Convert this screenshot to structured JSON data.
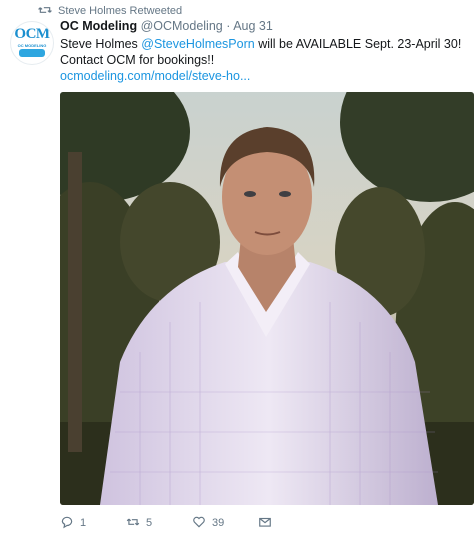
{
  "retweet_context": {
    "text": "Steve Holmes Retweeted",
    "icon": "retweet-icon"
  },
  "tweet": {
    "author": {
      "name": "OC Modeling",
      "handle": "@OCModeling",
      "avatar_logo_text": "OCM",
      "avatar_logo_subtext": "OC MODELING"
    },
    "date": "Aug 31",
    "separator": "·",
    "text": {
      "prefix": "Steve Holmes ",
      "mention": "@SteveHolmesPorn",
      "middle": " will be AVAILABLE Sept. 23-April 30! Contact OCM for bookings!!",
      "link": "ocmodeling.com/model/steve-ho..."
    },
    "media": {
      "type": "photo"
    },
    "actions": {
      "reply_count": "1",
      "retweet_count": "5",
      "like_count": "39"
    }
  },
  "colors": {
    "link": "#1b95e0",
    "muted": "#657786",
    "text": "#14171a"
  }
}
